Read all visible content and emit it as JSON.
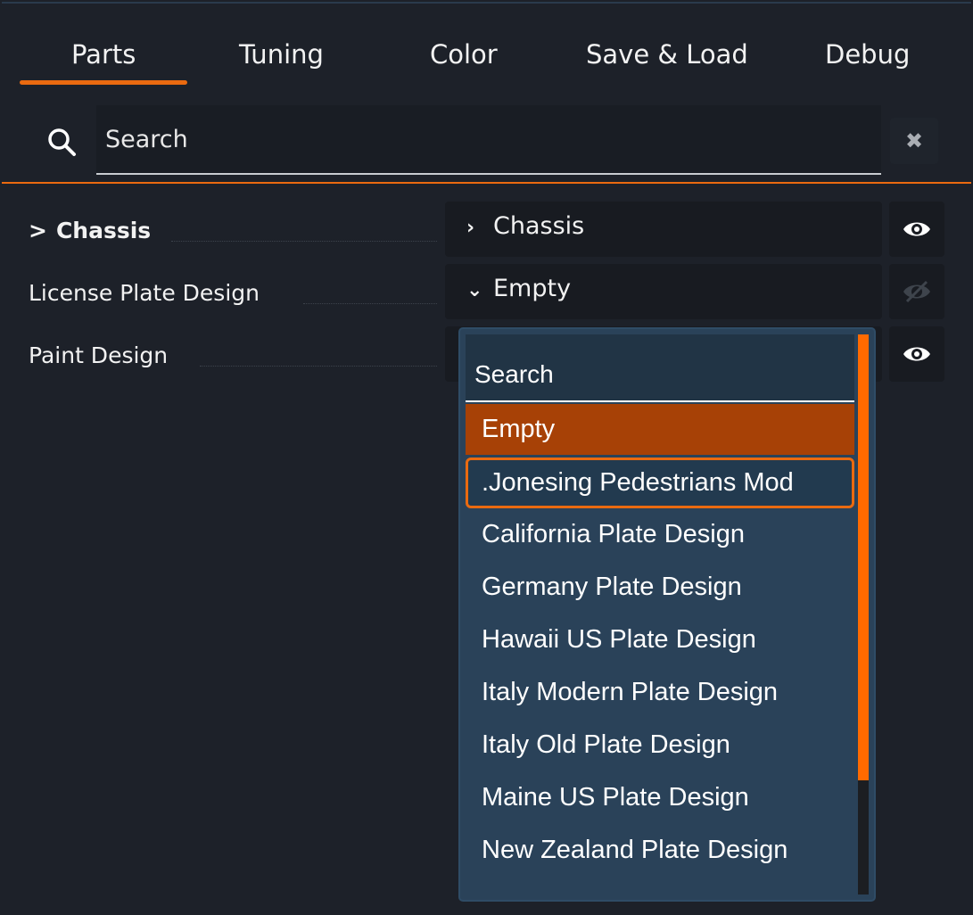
{
  "tabs": [
    {
      "label": "Parts",
      "active": true
    },
    {
      "label": "Tuning",
      "active": false
    },
    {
      "label": "Color",
      "active": false
    },
    {
      "label": "Save & Load",
      "active": false
    },
    {
      "label": "Debug",
      "active": false
    }
  ],
  "search": {
    "placeholder": "Search",
    "clear_icon": "close-icon"
  },
  "parts": [
    {
      "label": "Chassis",
      "collapsed_chevron": ">",
      "value": "Chassis",
      "value_chevron": ">",
      "visible": true
    },
    {
      "label": "License Plate Design",
      "value": "Empty",
      "value_chevron": "expanded",
      "visible": false
    },
    {
      "label": "Paint Design",
      "value": "",
      "visible": true
    }
  ],
  "dropdown": {
    "search_placeholder": "Search",
    "items": [
      {
        "label": "Empty",
        "state": "selected"
      },
      {
        "label": ".Jonesing Pedestrians Mod",
        "state": "focused"
      },
      {
        "label": "California Plate Design",
        "state": "normal"
      },
      {
        "label": "Germany Plate Design",
        "state": "normal"
      },
      {
        "label": "Hawaii US Plate Design",
        "state": "normal"
      },
      {
        "label": "Italy Modern Plate Design",
        "state": "normal"
      },
      {
        "label": "Italy Old Plate Design",
        "state": "normal"
      },
      {
        "label": "Maine US Plate Design",
        "state": "normal"
      },
      {
        "label": "New Zealand Plate Design",
        "state": "normal"
      }
    ]
  },
  "colors": {
    "accent": "#ea6a10",
    "panel": "#1d2129",
    "dropdown": "#2a4259",
    "selected": "#a74106"
  }
}
